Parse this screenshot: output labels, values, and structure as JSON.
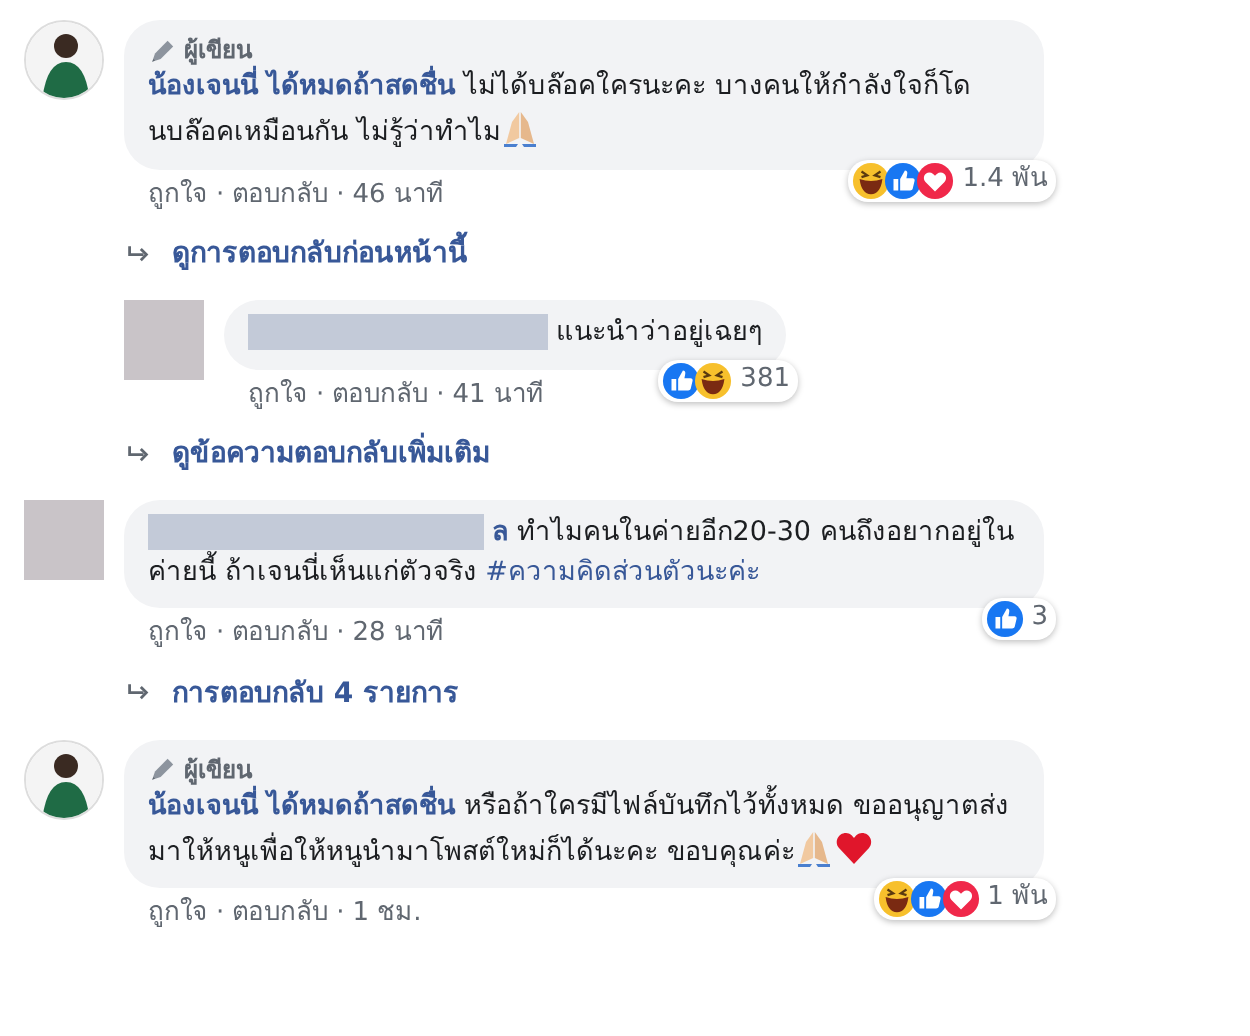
{
  "comments": [
    {
      "avatar": {
        "kind": "picture"
      },
      "author_badge": "ผู้เขียน",
      "author": "น้องเจนนี่ ได้หมดถ้าสดชื่น",
      "author_redacted": false,
      "text": "ไม่ได้บล๊อคใครนะคะ บางคนให้กำลังใจก็โดนบล๊อคเหมือนกัน ไม่รู้ว่าทำไม",
      "emoji": [
        {
          "kind": "pray"
        }
      ],
      "reactions": [
        {
          "kind": "haha"
        },
        {
          "kind": "like"
        },
        {
          "kind": "love"
        }
      ],
      "reaction_count": "1.4 พัน",
      "actions": [
        "ถูกใจ",
        "·",
        "ตอบกลับ",
        "·",
        "46 นาที"
      ],
      "children": [
        {
          "kind": "link",
          "label": "ดูการตอบกลับก่อนหน้านี้"
        },
        {
          "kind": "comment",
          "avatar": {
            "kind": "redacted"
          },
          "author_redacted": true,
          "text": "แนะนำว่าอยู่เฉยๆ",
          "reactions": [
            {
              "kind": "like"
            },
            {
              "kind": "haha"
            }
          ],
          "reaction_count": "381",
          "actions": [
            "ถูกใจ",
            "·",
            "ตอบกลับ",
            "·",
            "41 นาที"
          ]
        },
        {
          "kind": "link",
          "label": "ดูข้อความตอบกลับเพิ่มเติม"
        }
      ]
    },
    {
      "avatar": {
        "kind": "redacted"
      },
      "author_redacted": true,
      "author_tail": "ล",
      "text": "ทำไมคนในค่ายอีก20-30 คนถึงอยากอยู่ในค่ายนี้ ถ้าเจนนี่เห็นแก่ตัวจริง",
      "hashtag": "#ความคิดส่วนตัวนะค่ะ",
      "reactions": [
        {
          "kind": "like"
        }
      ],
      "reaction_count": "3",
      "actions": [
        "ถูกใจ",
        "·",
        "ตอบกลับ",
        "·",
        "28 นาที"
      ],
      "children": [
        {
          "kind": "link",
          "label": "การตอบกลับ 4 รายการ"
        }
      ]
    },
    {
      "avatar": {
        "kind": "picture"
      },
      "author_badge": "ผู้เขียน",
      "author": "น้องเจนนี่ ได้หมดถ้าสดชื่น",
      "author_redacted": false,
      "text": "หรือถ้าใครมีไฟล์บันทึกไว้ทั้งหมด ขออนุญาตส่งมาให้หนูเพื่อให้หนูนำมาโพสต์ใหม่ก็ได้นะคะ ขอบคุณค่ะ",
      "emoji": [
        {
          "kind": "pray"
        },
        {
          "kind": "heart"
        }
      ],
      "reactions": [
        {
          "kind": "haha"
        },
        {
          "kind": "like"
        },
        {
          "kind": "love"
        }
      ],
      "reaction_count": "1 พัน",
      "actions": [
        "ถูกใจ",
        "·",
        "ตอบกลับ",
        "·",
        "1 ชม."
      ]
    }
  ]
}
